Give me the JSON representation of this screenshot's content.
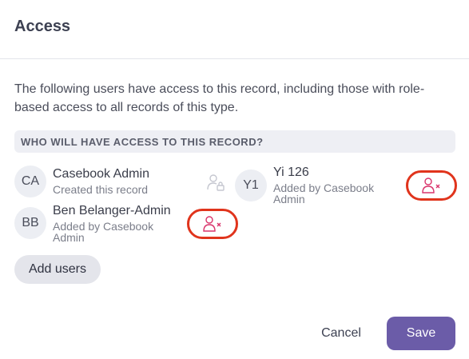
{
  "dialog": {
    "title": "Access",
    "description": "The following users have access to this record, including those with role-based access to all records of this type.",
    "section_label": "WHO WILL HAVE ACCESS TO THIS RECORD?"
  },
  "users": [
    {
      "initials": "CA",
      "name": "Casebook Admin",
      "subtitle": "Created this record",
      "icon": "lock-user-icon"
    },
    {
      "initials": "Y1",
      "name": "Yi 126",
      "subtitle": "Added by Casebook Admin",
      "icon": "remove-user-icon"
    },
    {
      "initials": "BB",
      "name": "Ben Belanger-Admin",
      "subtitle": "Added by Casebook Admin",
      "icon": "remove-user-icon"
    }
  ],
  "buttons": {
    "add_users": "Add users",
    "cancel": "Cancel",
    "save": "Save"
  },
  "colors": {
    "accent": "#6b5ca8",
    "remove_outline": "#e0341c",
    "remove_icon": "#d9336b"
  }
}
